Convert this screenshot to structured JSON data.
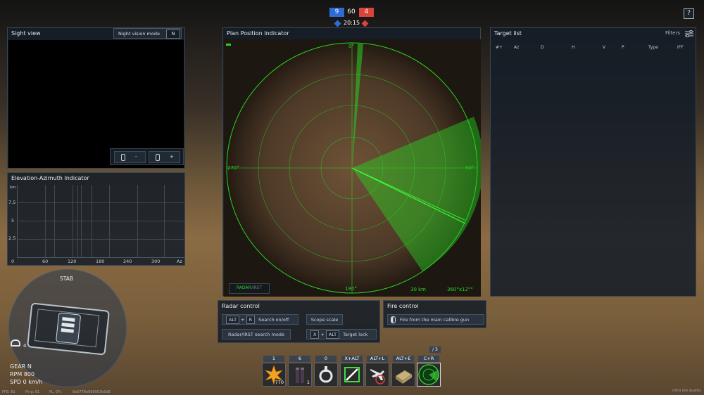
{
  "hud": {
    "score_blue": "9",
    "score_total": "60",
    "score_red": "4",
    "timer": "20:15",
    "help": "?"
  },
  "sight": {
    "title": "Sight view",
    "nv_label": "Night vision mode",
    "nv_key": "N",
    "zoom_out": "-",
    "zoom_in": "+"
  },
  "eai": {
    "title": "Elevation-Azimuth Indicator",
    "y_unit": "km",
    "y_ticks": [
      "7.5",
      "5",
      "2.5"
    ],
    "x_ticks": [
      "0",
      "60",
      "120",
      "180",
      "240",
      "300",
      "Az"
    ]
  },
  "ppi": {
    "title": "Plan Position Indicator",
    "n": "0°",
    "e": "90°",
    "s": "180°",
    "w": "270°",
    "mode": "RADAR",
    "mode_alt": "/IRST",
    "range": "30 km",
    "scan": "360°x12°°"
  },
  "targets": {
    "title": "Target list",
    "filters": "Filters",
    "columns": [
      "#+",
      "Az",
      "D",
      "H",
      "V",
      "P",
      "Type",
      "IFF"
    ]
  },
  "radar_control": {
    "title": "Radar control",
    "alt_key": "ALT",
    "plus": "+",
    "r_key": "R",
    "search_label": "Search on/off",
    "scope_label": "Scope scale",
    "mode_label": "Radar/IRST search mode",
    "x_key": "X",
    "alt_key2": "ALT",
    "lock_label": "Target lock"
  },
  "fire_control": {
    "title": "Fire control",
    "fire_label": "Fire from the main calibre gun"
  },
  "vehicle": {
    "stab": "STAB",
    "crew": "4",
    "gear": "GEAR N",
    "rpm": "RPM 800",
    "spd": "SPD 0 km/h"
  },
  "weapons": {
    "slots": [
      {
        "key": "1",
        "count": "770"
      },
      {
        "key": "6",
        "count": "1"
      },
      {
        "key": "0",
        "count": ""
      },
      {
        "key": "X+ALT",
        "count": ""
      },
      {
        "key": "ALT+L",
        "count": ""
      },
      {
        "key": "ALT+E",
        "count": ""
      },
      {
        "key": "C+R",
        "count": ""
      }
    ],
    "page": "/ 3"
  },
  "status": {
    "fps": "FPS: 81",
    "ping": "Ping: 81",
    "pl": "PL: 0%",
    "session": "6e0778e990003b0d6",
    "quality": "Ultra low quality"
  },
  "colors": {
    "radar": "#27d321",
    "blue": "#2d6bd6",
    "red": "#d8433a"
  }
}
